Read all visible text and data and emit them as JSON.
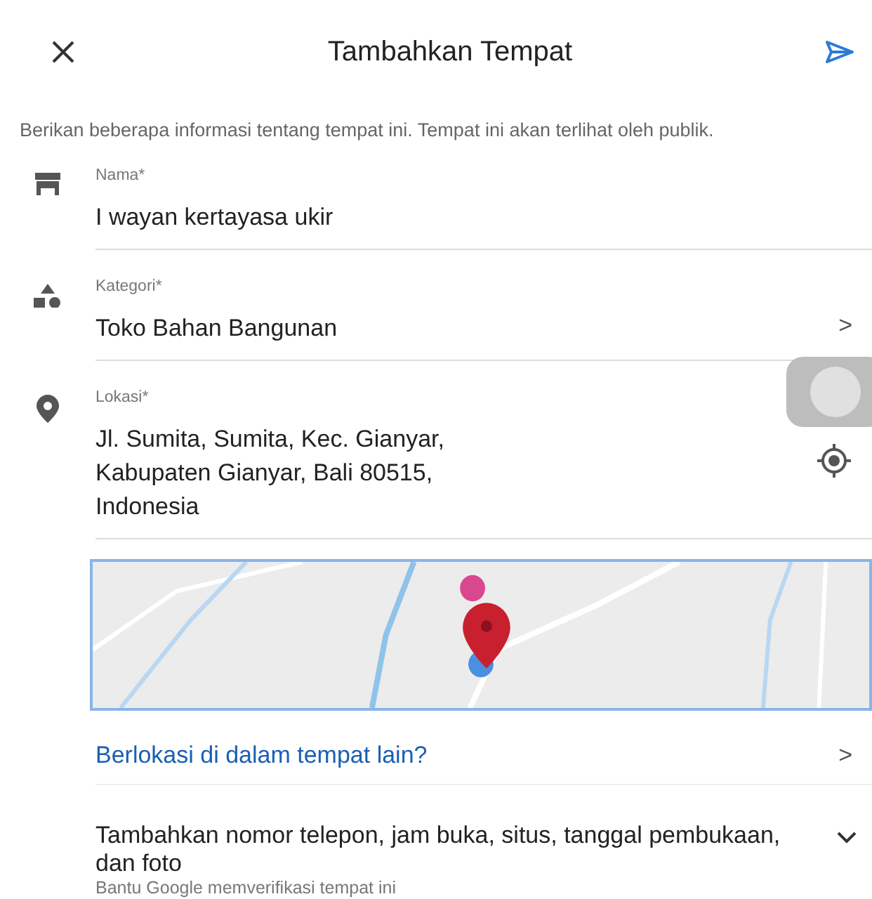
{
  "header": {
    "title": "Tambahkan Tempat"
  },
  "intro": "Berikan beberapa informasi tentang tempat ini. Tempat ini akan terlihat oleh publik.",
  "fields": [
    {
      "kind": "text",
      "label": "Nama*",
      "value": "I wayan kertayasa ukir"
    },
    {
      "kind": "select",
      "label": "Kategori*",
      "value": "Toko Bahan Bangunan",
      "chevron": ">"
    },
    {
      "kind": "location",
      "label": "Lokasi*",
      "value": "Jl. Sumita, Sumita, Kec. Gianyar,\nKabupaten Gianyar, Bali 80515,\nIndonesia"
    }
  ],
  "inside_link": {
    "label": "Berlokasi di dalam tempat lain?",
    "chevron": ">"
  },
  "more": {
    "title": "Tambahkan nomor telepon, jam buka, situs, tanggal pembukaan, dan foto",
    "subtitle": "Bantu Google memverifikasi tempat ini",
    "expanded": false
  }
}
